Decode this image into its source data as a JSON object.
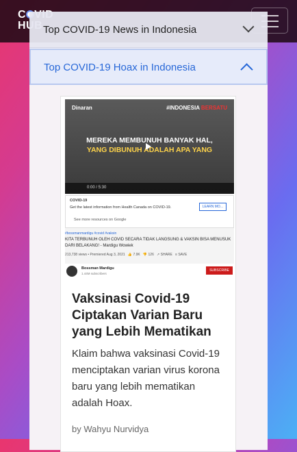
{
  "brand": {
    "line1_a": "C",
    "line1_b": "VID",
    "line2": "HUB"
  },
  "accordion": [
    {
      "label": "Top COVID-19 News in Indonesia",
      "expanded": false
    },
    {
      "label": "Top COVID-19 Hoax in Indonesia",
      "expanded": true
    }
  ],
  "thumbnail": {
    "channel": "Dinaran",
    "hashtag_a": "#INDONESIA",
    "hashtag_b": "BERSATU",
    "headline_1": "MEREKA MEMBUNUH BANYAK HAL,",
    "headline_2": "YANG DIBUNUH ADALAH APA YANG",
    "time": "0:00 / 5:30",
    "info_title": "COVID-19",
    "info_text": "Get the latest information from Health Canada on COVID-19.",
    "learn_more": "LEARN MO...",
    "info_link": "See more resources on Google",
    "hashtags": "#bossmanmardigu #covid #vaksin",
    "video_title": "KITA TERBUNUH OLEH COVID SECARA TIDAK LANGSUNG & VAKSIN BISA MENUSUK DARI BELAKANG! - Mardigu Wowiek",
    "views": "213,738 views • Premiered Aug 3, 2021",
    "likes": "7.9K",
    "dislikes": "126",
    "share": "SHARE",
    "save": "SAVE",
    "channel_name": "Bossman Mardigu",
    "subscribers": "1.44M subscribers",
    "subscribe": "SUBSCRIBE"
  },
  "article": {
    "title": "Vaksinasi Covid-19 Ciptakan Varian Baru yang Lebih Mematikan",
    "description": "Klaim bahwa vaksinasi Covid-19 menciptakan varian virus korona baru yang lebih mematikan adalah Hoax.",
    "byline": "by Wahyu Nurvidya"
  },
  "colors": {
    "accent": "#2667d8",
    "nav_bg": "#200a16"
  }
}
